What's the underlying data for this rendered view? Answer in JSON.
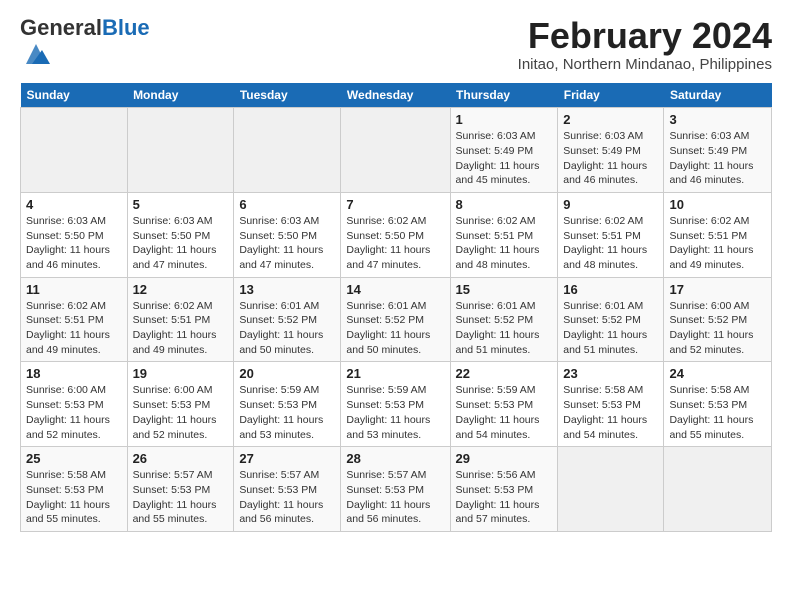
{
  "header": {
    "logo_general": "General",
    "logo_blue": "Blue",
    "month_title": "February 2024",
    "location": "Initao, Northern Mindanao, Philippines"
  },
  "calendar": {
    "days_of_week": [
      "Sunday",
      "Monday",
      "Tuesday",
      "Wednesday",
      "Thursday",
      "Friday",
      "Saturday"
    ],
    "weeks": [
      [
        {
          "day": "",
          "info": ""
        },
        {
          "day": "",
          "info": ""
        },
        {
          "day": "",
          "info": ""
        },
        {
          "day": "",
          "info": ""
        },
        {
          "day": "1",
          "info": "Sunrise: 6:03 AM\nSunset: 5:49 PM\nDaylight: 11 hours and 45 minutes."
        },
        {
          "day": "2",
          "info": "Sunrise: 6:03 AM\nSunset: 5:49 PM\nDaylight: 11 hours and 46 minutes."
        },
        {
          "day": "3",
          "info": "Sunrise: 6:03 AM\nSunset: 5:49 PM\nDaylight: 11 hours and 46 minutes."
        }
      ],
      [
        {
          "day": "4",
          "info": "Sunrise: 6:03 AM\nSunset: 5:50 PM\nDaylight: 11 hours and 46 minutes."
        },
        {
          "day": "5",
          "info": "Sunrise: 6:03 AM\nSunset: 5:50 PM\nDaylight: 11 hours and 47 minutes."
        },
        {
          "day": "6",
          "info": "Sunrise: 6:03 AM\nSunset: 5:50 PM\nDaylight: 11 hours and 47 minutes."
        },
        {
          "day": "7",
          "info": "Sunrise: 6:02 AM\nSunset: 5:50 PM\nDaylight: 11 hours and 47 minutes."
        },
        {
          "day": "8",
          "info": "Sunrise: 6:02 AM\nSunset: 5:51 PM\nDaylight: 11 hours and 48 minutes."
        },
        {
          "day": "9",
          "info": "Sunrise: 6:02 AM\nSunset: 5:51 PM\nDaylight: 11 hours and 48 minutes."
        },
        {
          "day": "10",
          "info": "Sunrise: 6:02 AM\nSunset: 5:51 PM\nDaylight: 11 hours and 49 minutes."
        }
      ],
      [
        {
          "day": "11",
          "info": "Sunrise: 6:02 AM\nSunset: 5:51 PM\nDaylight: 11 hours and 49 minutes."
        },
        {
          "day": "12",
          "info": "Sunrise: 6:02 AM\nSunset: 5:51 PM\nDaylight: 11 hours and 49 minutes."
        },
        {
          "day": "13",
          "info": "Sunrise: 6:01 AM\nSunset: 5:52 PM\nDaylight: 11 hours and 50 minutes."
        },
        {
          "day": "14",
          "info": "Sunrise: 6:01 AM\nSunset: 5:52 PM\nDaylight: 11 hours and 50 minutes."
        },
        {
          "day": "15",
          "info": "Sunrise: 6:01 AM\nSunset: 5:52 PM\nDaylight: 11 hours and 51 minutes."
        },
        {
          "day": "16",
          "info": "Sunrise: 6:01 AM\nSunset: 5:52 PM\nDaylight: 11 hours and 51 minutes."
        },
        {
          "day": "17",
          "info": "Sunrise: 6:00 AM\nSunset: 5:52 PM\nDaylight: 11 hours and 52 minutes."
        }
      ],
      [
        {
          "day": "18",
          "info": "Sunrise: 6:00 AM\nSunset: 5:53 PM\nDaylight: 11 hours and 52 minutes."
        },
        {
          "day": "19",
          "info": "Sunrise: 6:00 AM\nSunset: 5:53 PM\nDaylight: 11 hours and 52 minutes."
        },
        {
          "day": "20",
          "info": "Sunrise: 5:59 AM\nSunset: 5:53 PM\nDaylight: 11 hours and 53 minutes."
        },
        {
          "day": "21",
          "info": "Sunrise: 5:59 AM\nSunset: 5:53 PM\nDaylight: 11 hours and 53 minutes."
        },
        {
          "day": "22",
          "info": "Sunrise: 5:59 AM\nSunset: 5:53 PM\nDaylight: 11 hours and 54 minutes."
        },
        {
          "day": "23",
          "info": "Sunrise: 5:58 AM\nSunset: 5:53 PM\nDaylight: 11 hours and 54 minutes."
        },
        {
          "day": "24",
          "info": "Sunrise: 5:58 AM\nSunset: 5:53 PM\nDaylight: 11 hours and 55 minutes."
        }
      ],
      [
        {
          "day": "25",
          "info": "Sunrise: 5:58 AM\nSunset: 5:53 PM\nDaylight: 11 hours and 55 minutes."
        },
        {
          "day": "26",
          "info": "Sunrise: 5:57 AM\nSunset: 5:53 PM\nDaylight: 11 hours and 55 minutes."
        },
        {
          "day": "27",
          "info": "Sunrise: 5:57 AM\nSunset: 5:53 PM\nDaylight: 11 hours and 56 minutes."
        },
        {
          "day": "28",
          "info": "Sunrise: 5:57 AM\nSunset: 5:53 PM\nDaylight: 11 hours and 56 minutes."
        },
        {
          "day": "29",
          "info": "Sunrise: 5:56 AM\nSunset: 5:53 PM\nDaylight: 11 hours and 57 minutes."
        },
        {
          "day": "",
          "info": ""
        },
        {
          "day": "",
          "info": ""
        }
      ]
    ]
  }
}
